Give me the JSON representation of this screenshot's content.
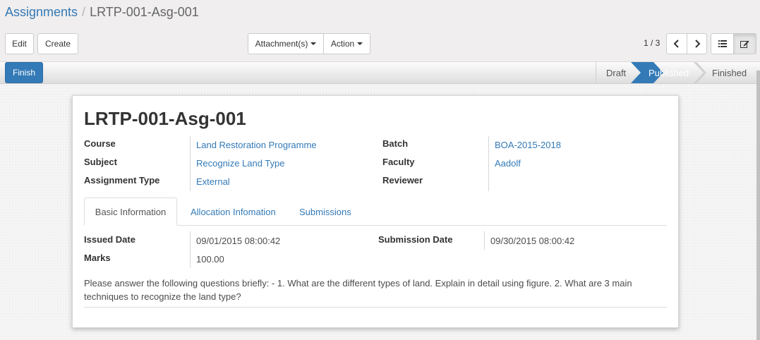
{
  "breadcrumb": {
    "parent": "Assignments",
    "separator": "/",
    "current": "LRTP-001-Asg-001"
  },
  "toolbar": {
    "edit_label": "Edit",
    "create_label": "Create",
    "attachments_label": "Attachment(s)",
    "action_label": "Action",
    "pager": "1 / 3",
    "prev_icon": "chevron-left-icon",
    "next_icon": "chevron-right-icon",
    "list_view_icon": "list-icon",
    "form_view_icon": "edit-icon"
  },
  "statusbar": {
    "finish_label": "Finish",
    "stages": [
      "Draft",
      "Published",
      "Finished"
    ],
    "current_stage": "Published"
  },
  "record": {
    "title": "LRTP-001-Asg-001",
    "course_label": "Course",
    "course": "Land Restoration Programme",
    "subject_label": "Subject",
    "subject": "Recognize Land Type",
    "type_label": "Assignment Type",
    "type": "External",
    "batch_label": "Batch",
    "batch": "BOA-2015-2018",
    "faculty_label": "Faculty",
    "faculty": "Aadolf",
    "reviewer_label": "Reviewer",
    "reviewer": ""
  },
  "tabs": [
    "Basic Information",
    "Allocation Infomation",
    "Submissions"
  ],
  "basic": {
    "issued_label": "Issued Date",
    "issued": "09/01/2015 08:00:42",
    "submission_label": "Submission Date",
    "submission": "09/30/2015 08:00:42",
    "marks_label": "Marks",
    "marks": "100.00",
    "description": "Please answer the following questions briefly: - 1. What are the different types of land. Explain in detail using figure. 2. What are 3 main techniques to recognize the land type?"
  },
  "colors": {
    "link": "#337ab7",
    "primary_button": "#337ab7",
    "active_stage": "#337ab7"
  }
}
